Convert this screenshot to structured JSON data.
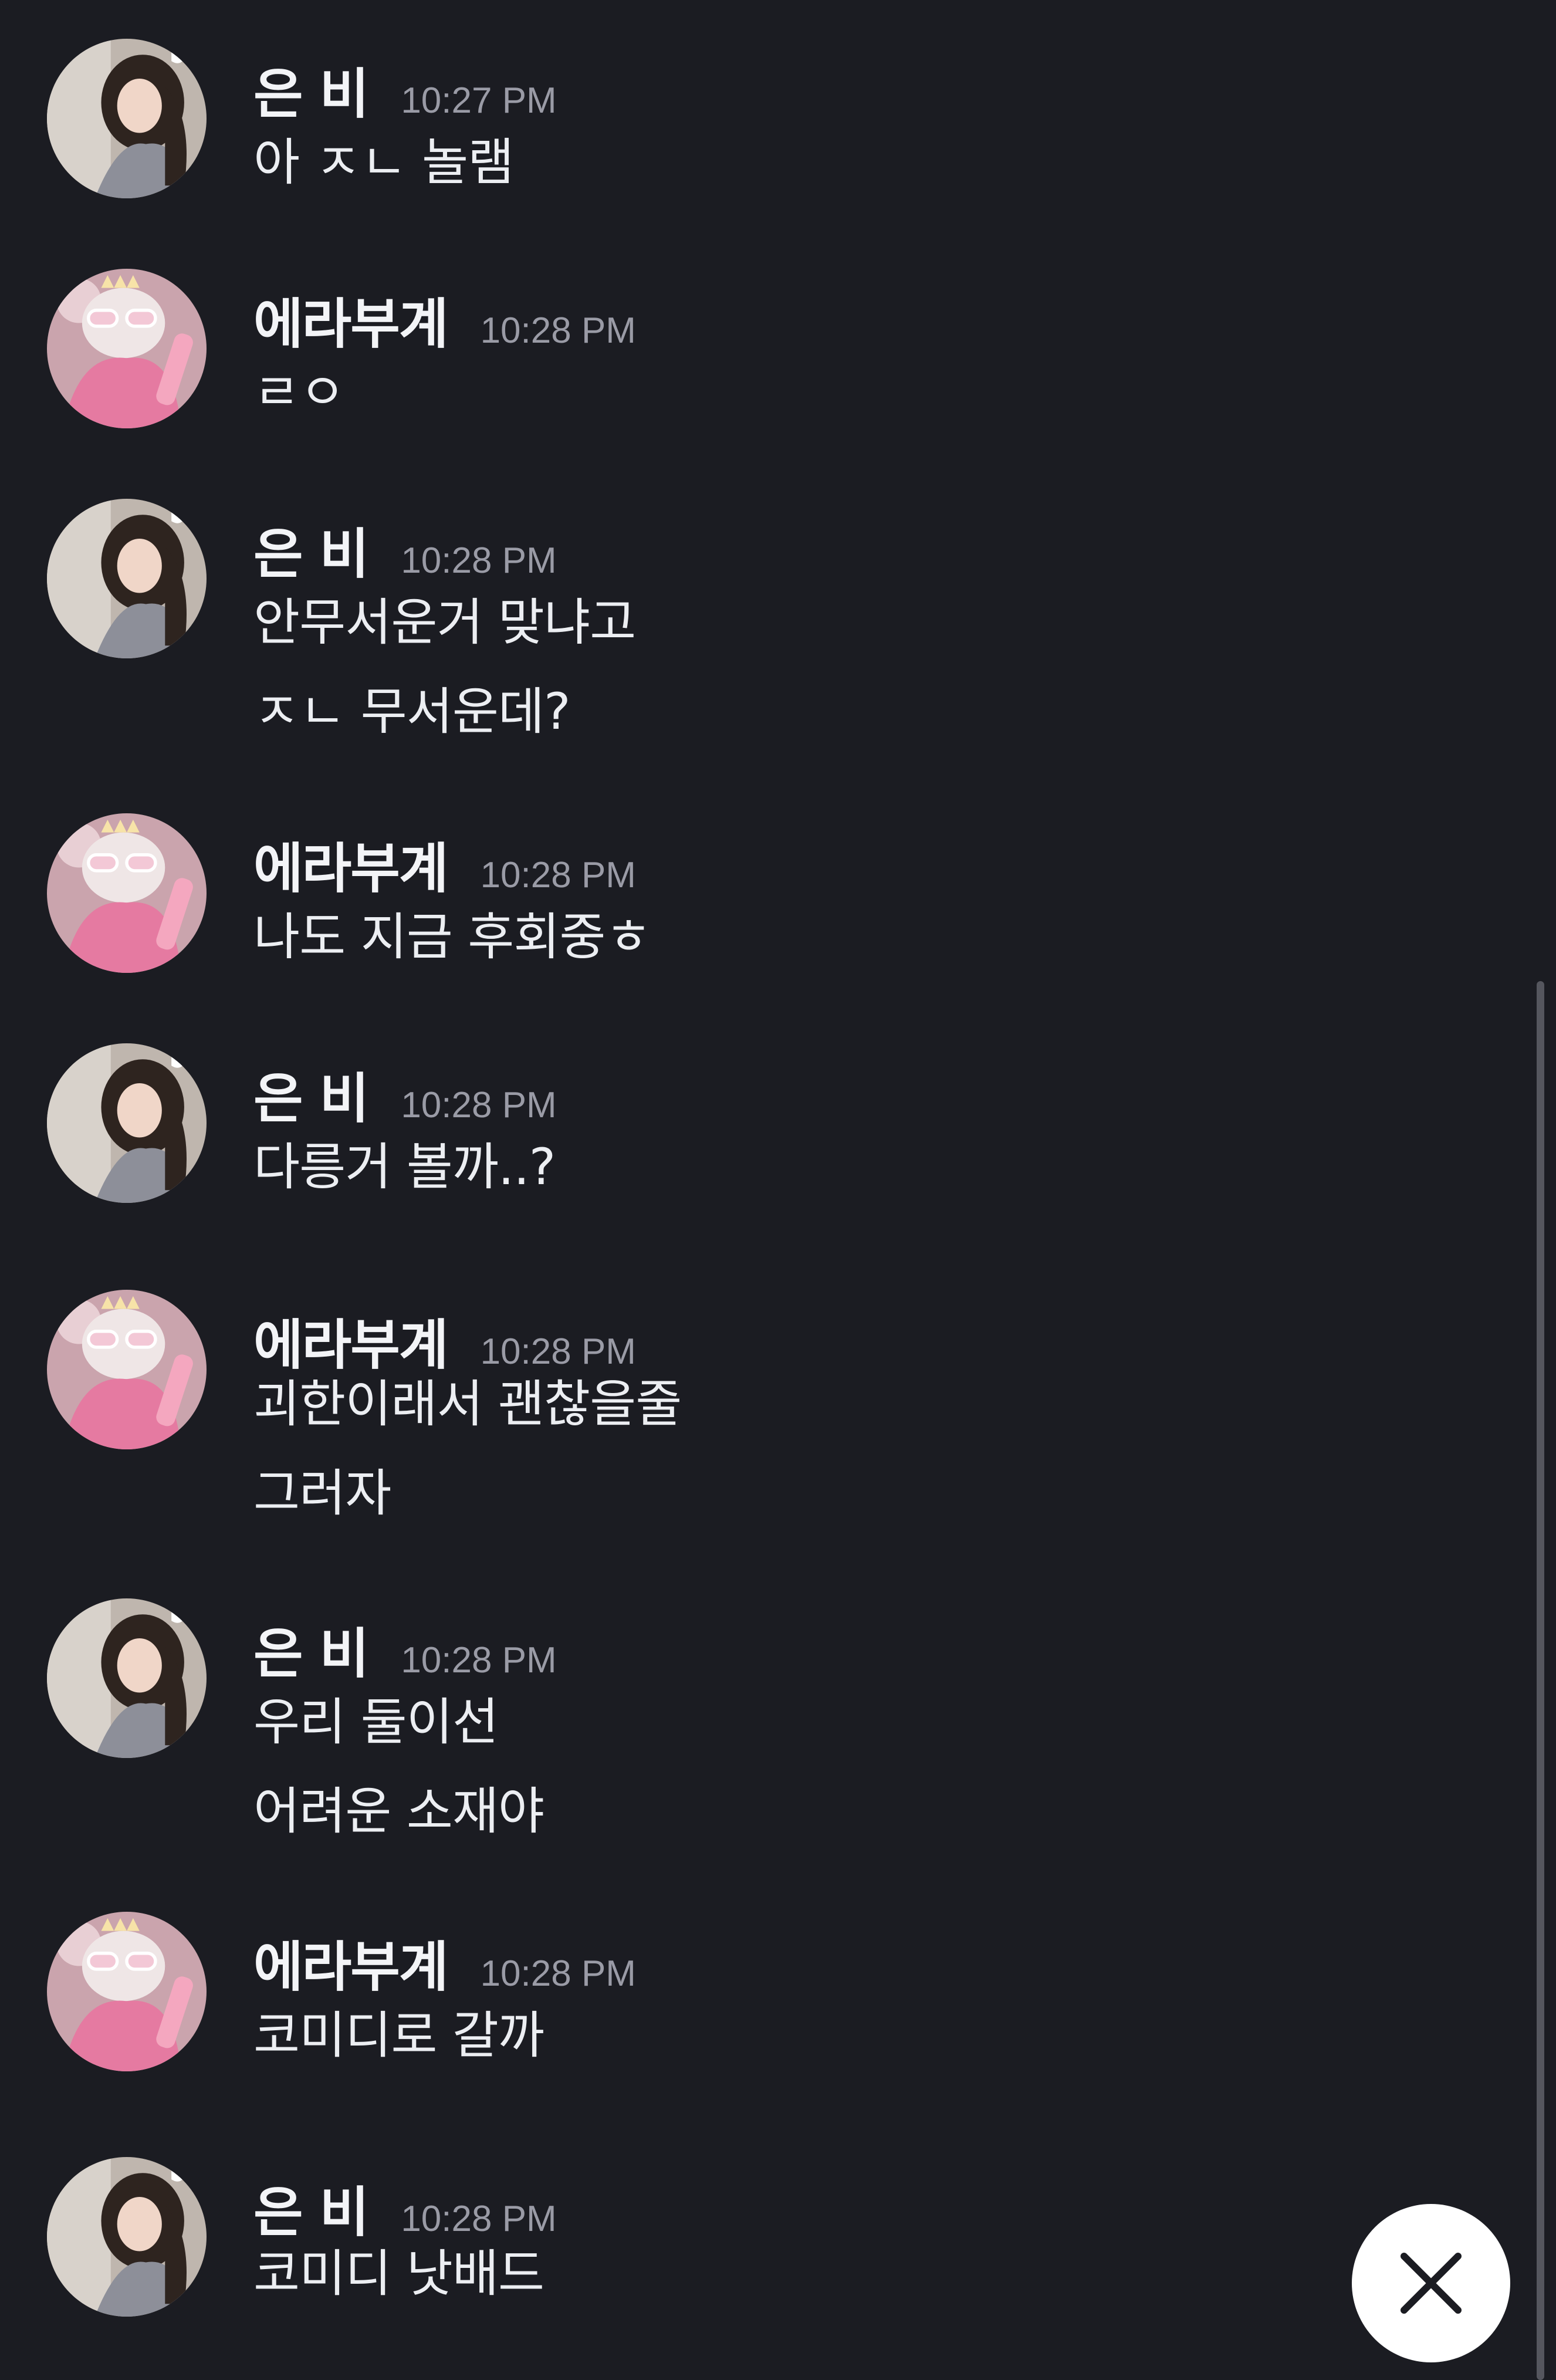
{
  "users": {
    "eunbi": {
      "name": "은 비"
    },
    "erabugye": {
      "name": "에라부계"
    }
  },
  "messages": [
    {
      "user": "은 비",
      "time": "10:27 PM",
      "lines": [
        "아 ㅈㄴ 놀램"
      ]
    },
    {
      "user": "에라부계",
      "time": "10:28 PM",
      "lines": [
        "ㄹㅇ"
      ]
    },
    {
      "user": "은 비",
      "time": "10:28 PM",
      "lines": [
        "안무서운거 맞냐고",
        "ㅈㄴ 무서운데?"
      ]
    },
    {
      "user": "에라부계",
      "time": "10:28 PM",
      "lines": [
        "나도 지금 후회중ㅎ"
      ]
    },
    {
      "user": "은 비",
      "time": "10:28 PM",
      "lines": [
        "다릉거 볼까..?"
      ]
    },
    {
      "user": "에라부계",
      "time": "10:28 PM",
      "lines": [
        "괴한이래서 괜찮을줄",
        "그러자"
      ]
    },
    {
      "user": "은 비",
      "time": "10:28 PM",
      "lines": [
        "우리 둘이선",
        "어려운 소재야"
      ]
    },
    {
      "user": "에라부계",
      "time": "10:28 PM",
      "lines": [
        "코미디로 갈까"
      ]
    },
    {
      "user": "은 비",
      "time": "10:28 PM",
      "lines": [
        "코미디 낫배드"
      ]
    }
  ],
  "icons": {
    "close_button": "close-icon",
    "avatar_eunbi": "avatar-portrait-icon",
    "avatar_erabugye": "avatar-pink-cat-icon"
  },
  "colors": {
    "background": "#1b1c22",
    "username": "#f3f4f7",
    "timestamp": "#9a9ba6",
    "message_text": "#eceef2",
    "close_button_bg": "#ffffff"
  }
}
